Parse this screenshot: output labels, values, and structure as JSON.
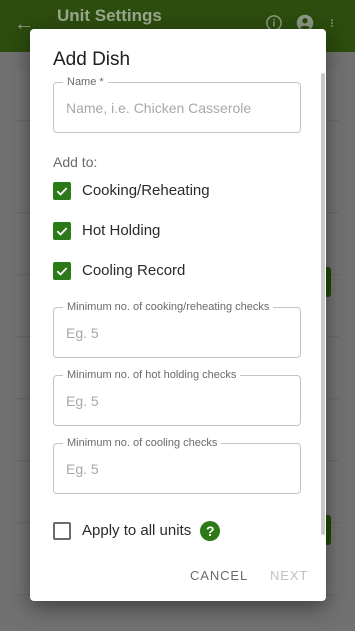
{
  "appbar": {
    "title": "Unit Settings",
    "back_icon": "arrow-back-icon",
    "icons": [
      "info-icon",
      "account-icon",
      "more-vert-icon"
    ]
  },
  "dialog": {
    "title": "Add Dish",
    "name_field": {
      "label": "Name *",
      "placeholder": "Name, i.e. Chicken Casserole",
      "value": ""
    },
    "add_to_label": "Add to:",
    "checkboxes": [
      {
        "label": "Cooking/Reheating",
        "checked": true
      },
      {
        "label": "Hot Holding",
        "checked": true
      },
      {
        "label": "Cooling Record",
        "checked": true
      }
    ],
    "min_fields": [
      {
        "label": "Minimum no. of cooking/reheating checks",
        "placeholder": "Eg. 5",
        "value": ""
      },
      {
        "label": "Minimum no. of hot holding checks",
        "placeholder": "Eg. 5",
        "value": ""
      },
      {
        "label": "Minimum no. of cooling checks",
        "placeholder": "Eg. 5",
        "value": ""
      }
    ],
    "apply_all": {
      "label": "Apply to all units",
      "checked": false,
      "help_glyph": "?"
    },
    "buttons": {
      "cancel": "CANCEL",
      "next": "NEXT"
    }
  },
  "colors": {
    "accent": "#2c7a17",
    "appbar": "#2c4d0e"
  }
}
